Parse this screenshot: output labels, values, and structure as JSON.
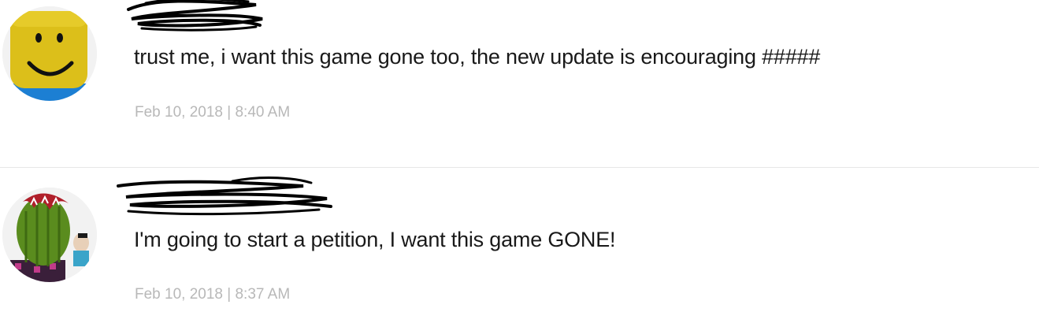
{
  "comments": [
    {
      "username": "",
      "text": "trust me, i want this game gone too, the new update is encouraging #####",
      "timestamp": "Feb 10, 2018 | 8:40 AM",
      "avatar_icon": "noob-avatar-icon"
    },
    {
      "username": "",
      "text": "I'm going to start a petition, I want this game GONE!",
      "timestamp": "Feb 10, 2018 | 8:37 AM",
      "avatar_icon": "cactus-avatar-icon"
    }
  ],
  "colors": {
    "username": "#00a2ff",
    "text": "#191919",
    "timestamp": "#b8b8b8",
    "divider": "#e7e7e7"
  }
}
